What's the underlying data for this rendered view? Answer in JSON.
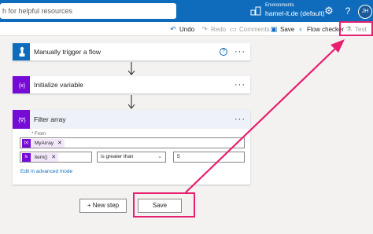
{
  "topbar": {
    "search_placeholder": "h for helpful resources",
    "environments_label": "Environments",
    "environment_name": "hamel-it.de (default)",
    "avatar_initials": "JH",
    "background": "#0f6cbd"
  },
  "commands": {
    "undo": "Undo",
    "redo": "Redo",
    "comments": "Comments",
    "save": "Save",
    "flow_checker": "Flow checker",
    "test": "Test"
  },
  "steps": [
    {
      "title": "Manually trigger a flow",
      "accent": "#0f6cbd",
      "icon": "hand-touch-icon"
    },
    {
      "title": "Initialize variable",
      "accent": "#770bd6",
      "icon": "variable-icon",
      "icon_glyph": "{x}"
    },
    {
      "title": "Filter array",
      "accent": "#770bd6",
      "icon": "filter-array-icon",
      "icon_glyph": "{∇}"
    }
  ],
  "filter_array": {
    "from_label": "* From",
    "from_token": "MyArray",
    "left_token": "item()",
    "operator": "is greater than",
    "value": "5",
    "advanced_link": "Edit in advanced mode"
  },
  "buttons": {
    "new_step": "+ New step",
    "save": "Save"
  },
  "annotation_color": "#e81f6e"
}
